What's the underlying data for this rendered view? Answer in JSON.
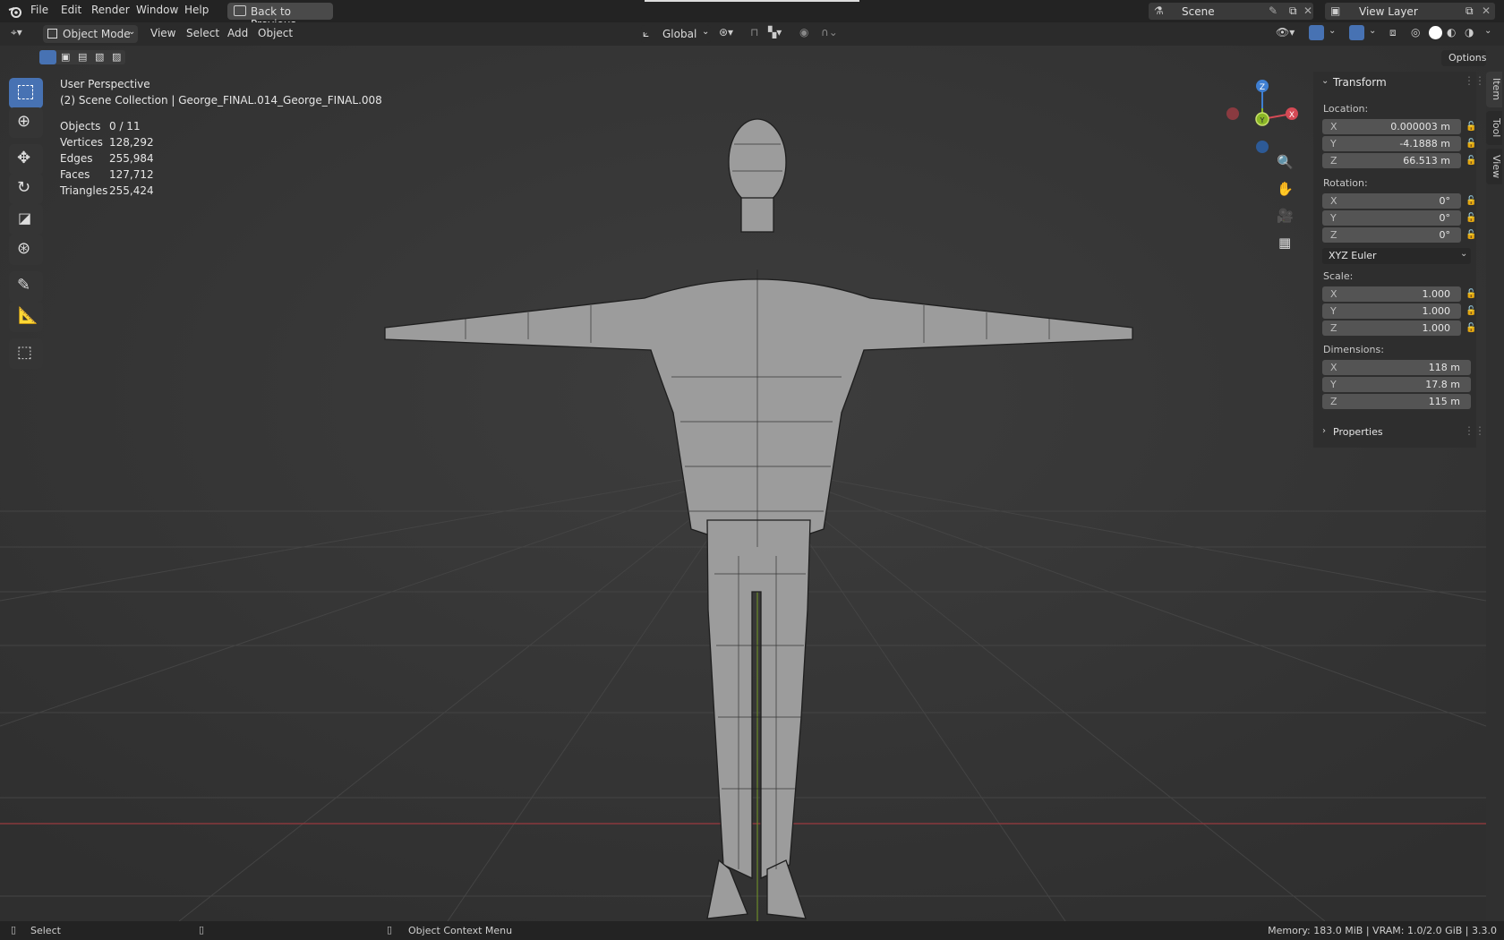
{
  "menubar": {
    "items": [
      "File",
      "Edit",
      "Render",
      "Window",
      "Help"
    ],
    "back_button": "Back to Previous",
    "scene": "Scene",
    "view_layer": "View Layer"
  },
  "viewport_header": {
    "mode": "Object Mode",
    "menus": [
      "View",
      "Select",
      "Add",
      "Object"
    ],
    "orientation": "Global",
    "options": "Options"
  },
  "overlay": {
    "view_name": "User Perspective",
    "collection": "(2) Scene Collection | George_FINAL.014_George_FINAL.008",
    "stats": [
      {
        "label": "Objects",
        "value": "0 / 11"
      },
      {
        "label": "Vertices",
        "value": "128,292"
      },
      {
        "label": "Edges",
        "value": "255,984"
      },
      {
        "label": "Faces",
        "value": "127,712"
      },
      {
        "label": "Triangles",
        "value": "255,424"
      }
    ]
  },
  "gizmo": {
    "z": "Z",
    "y": "Y",
    "x": "X"
  },
  "transform_panel": {
    "title": "Transform",
    "location_label": "Location:",
    "location": [
      {
        "axis": "X",
        "value": "0.000003 m"
      },
      {
        "axis": "Y",
        "value": "-4.1888 m"
      },
      {
        "axis": "Z",
        "value": "66.513 m"
      }
    ],
    "rotation_label": "Rotation:",
    "rotation": [
      {
        "axis": "X",
        "value": "0°"
      },
      {
        "axis": "Y",
        "value": "0°"
      },
      {
        "axis": "Z",
        "value": "0°"
      }
    ],
    "rotation_mode": "XYZ Euler",
    "scale_label": "Scale:",
    "scale": [
      {
        "axis": "X",
        "value": "1.000"
      },
      {
        "axis": "Y",
        "value": "1.000"
      },
      {
        "axis": "Z",
        "value": "1.000"
      }
    ],
    "dimensions_label": "Dimensions:",
    "dimensions": [
      {
        "axis": "X",
        "value": "118 m"
      },
      {
        "axis": "Y",
        "value": "17.8 m"
      },
      {
        "axis": "Z",
        "value": "115 m"
      }
    ],
    "properties": "Properties"
  },
  "side_tabs": [
    "Item",
    "Tool",
    "View"
  ],
  "statusbar": {
    "select": "Select",
    "context_menu": "Object Context Menu",
    "memory": "Memory: 183.0 MiB | VRAM: 1.0/2.0 GiB | 3.3.0"
  },
  "colors": {
    "accent": "#4772b3",
    "axis_x": "#d44a55",
    "axis_y": "#8ab726",
    "axis_z": "#3f7fd2"
  }
}
